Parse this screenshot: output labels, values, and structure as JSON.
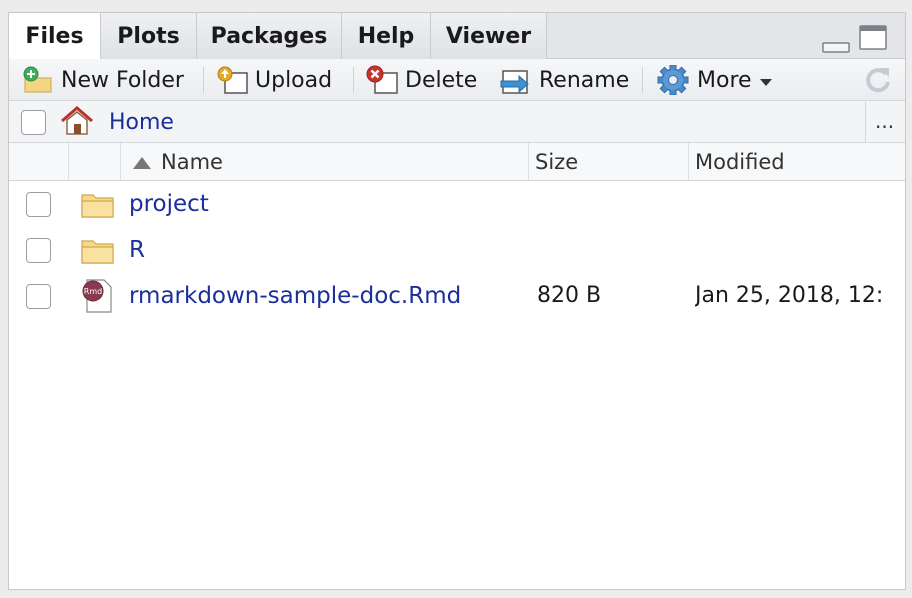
{
  "tabs": [
    {
      "label": "Files",
      "active": true
    },
    {
      "label": "Plots",
      "active": false
    },
    {
      "label": "Packages",
      "active": false
    },
    {
      "label": "Help",
      "active": false
    },
    {
      "label": "Viewer",
      "active": false
    }
  ],
  "toolbar": {
    "new_folder": "New Folder",
    "upload": "Upload",
    "delete": "Delete",
    "rename": "Rename",
    "more": "More"
  },
  "breadcrumb": {
    "home": "Home",
    "overflow": "..."
  },
  "table": {
    "columns": {
      "name": "Name",
      "size": "Size",
      "modified": "Modified"
    },
    "sort": "ascending",
    "rows": [
      {
        "icon": "folder-icon",
        "name": "project",
        "size": "",
        "modified": ""
      },
      {
        "icon": "folder-icon",
        "name": "R",
        "size": "",
        "modified": ""
      },
      {
        "icon": "rmd-file-icon",
        "name": "rmarkdown-sample-doc.Rmd",
        "size": "820 B",
        "modified": "Jan 25, 2018, 12:"
      }
    ]
  },
  "rmd_icon_text": "Rmd",
  "colors": {
    "link": "#1a2e9c",
    "delete_red": "#c8332e",
    "gear_blue": "#4a8ac9"
  }
}
